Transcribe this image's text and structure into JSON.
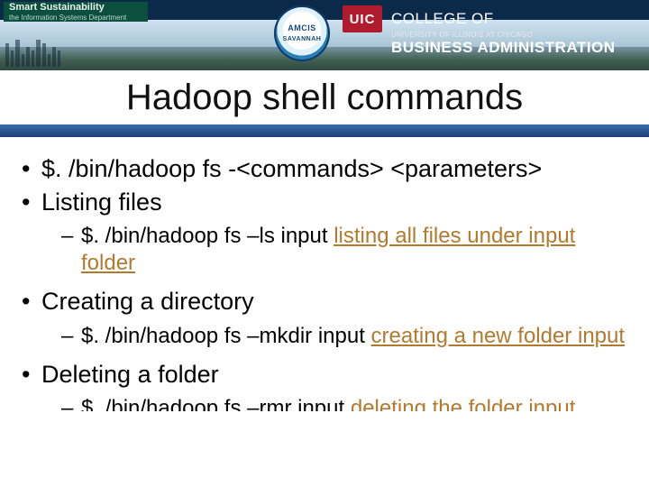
{
  "banner": {
    "badge_line1": "Smart Sustainability",
    "badge_line2": "the Information Systems Department",
    "amcis_top": "AMCIS",
    "amcis_bottom": "SAVANNAH",
    "uic_mark": "UIC",
    "uic_college": "COLLEGE OF",
    "uic_sub": "UNIVERSITY OF ILLINOIS AT CHICAGO",
    "uic_ba": "BUSINESS ADMINISTRATION"
  },
  "title": "Hadoop shell commands",
  "content": {
    "li1": "$. /bin/hadoop fs -<commands> <parameters>",
    "li2": "Listing files",
    "li2_sub_cmd": "$. /bin/hadoop fs –ls input  ",
    "li2_sub_desc": "listing all files under input folder",
    "li3": "Creating a directory",
    "li3_sub_cmd": "$. /bin/hadoop fs –mkdir input ",
    "li3_sub_desc": "creating a new folder input",
    "li4": "Deleting a folder",
    "li4_sub_cmd": "$. /bin/hadoop fs –rmr input ",
    "li4_sub_desc": "deleting the folder input"
  }
}
